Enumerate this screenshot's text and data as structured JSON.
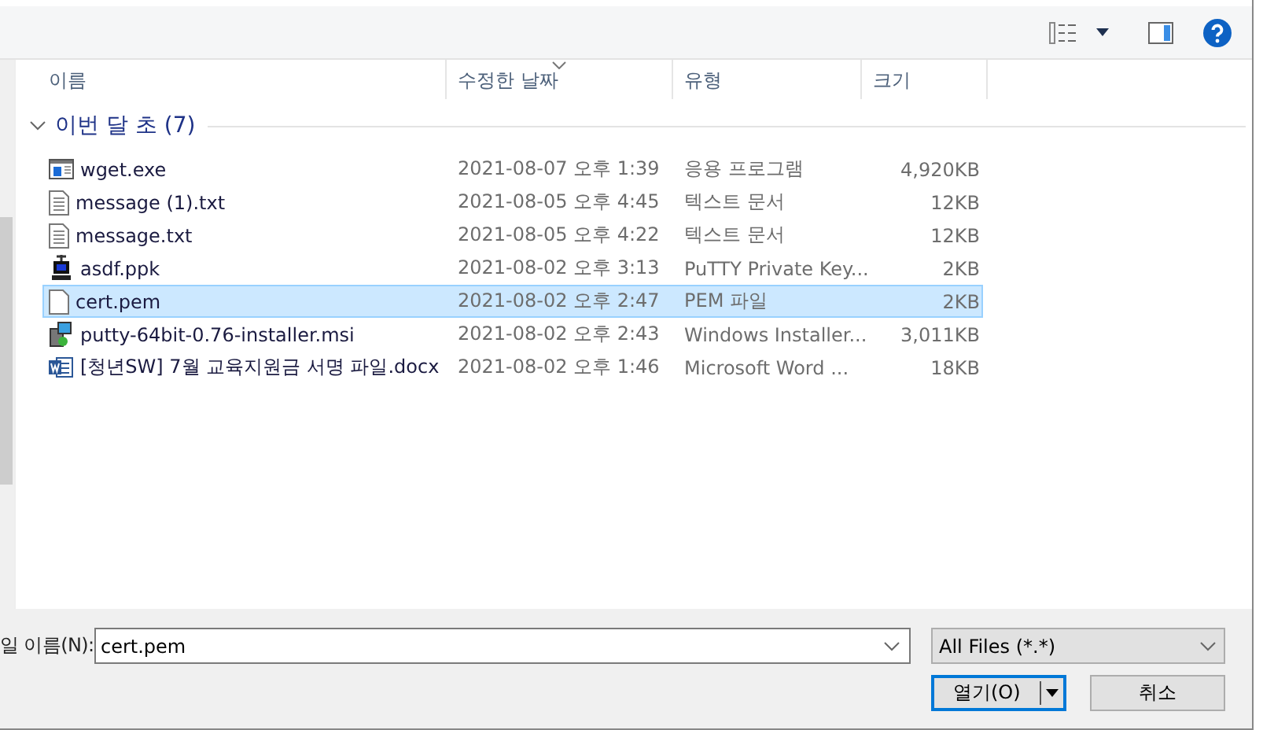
{
  "columns": [
    {
      "label": "이름",
      "sorted": false
    },
    {
      "label": "수정한 날짜",
      "sorted": true
    },
    {
      "label": "유형",
      "sorted": false
    },
    {
      "label": "크기",
      "sorted": false
    }
  ],
  "group": {
    "label": "이번 달 초 (7)",
    "expanded": true
  },
  "files": [
    {
      "kind": "exe",
      "name": "wget.exe",
      "date": "2021-08-07 오후 1:39",
      "type": "응용 프로그램",
      "size": "4,920KB",
      "selected": false
    },
    {
      "kind": "txt",
      "name": "message (1).txt",
      "date": "2021-08-05 오후 4:45",
      "type": "텍스트 문서",
      "size": "12KB",
      "selected": false
    },
    {
      "kind": "txt",
      "name": "message.txt",
      "date": "2021-08-05 오후 4:22",
      "type": "텍스트 문서",
      "size": "12KB",
      "selected": false
    },
    {
      "kind": "ppk",
      "name": "asdf.ppk",
      "date": "2021-08-02 오후 3:13",
      "type": "PuTTY Private Key...",
      "size": "2KB",
      "selected": false
    },
    {
      "kind": "blank",
      "name": "cert.pem",
      "date": "2021-08-02 오후 2:47",
      "type": "PEM 파일",
      "size": "2KB",
      "selected": true
    },
    {
      "kind": "msi",
      "name": "putty-64bit-0.76-installer.msi",
      "date": "2021-08-02 오후 2:43",
      "type": "Windows Installer...",
      "size": "3,011KB",
      "selected": false
    },
    {
      "kind": "docx",
      "name": "[청년SW] 7월 교육지원금 서명 파일.docx",
      "date": "2021-08-02 오후 1:46",
      "type": "Microsoft Word ...",
      "size": "18KB",
      "selected": false
    }
  ],
  "filename": {
    "label": "일 이름(N):",
    "value": "cert.pem"
  },
  "filter": {
    "value": "All Files (*.*)"
  },
  "buttons": {
    "open": "열기(O)",
    "cancel": "취소"
  }
}
